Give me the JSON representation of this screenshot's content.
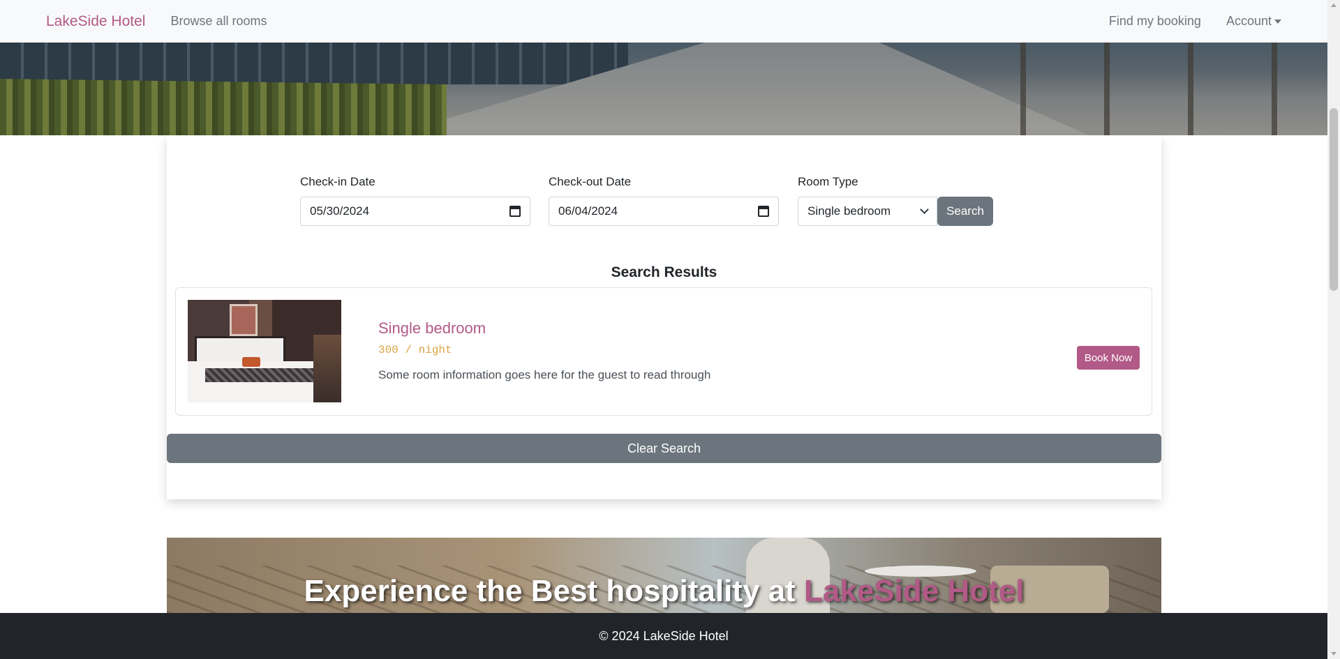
{
  "navbar": {
    "brand": "LakeSide Hotel",
    "browse": "Browse all rooms",
    "find_booking": "Find my booking",
    "account": "Account"
  },
  "search": {
    "checkin_label": "Check-in Date",
    "checkin_value": "05/30/2024",
    "checkout_label": "Check-out Date",
    "checkout_value": "06/04/2024",
    "roomtype_label": "Room Type",
    "roomtype_value": "Single bedroom",
    "search_button": "Search"
  },
  "results": {
    "title": "Search Results",
    "items": [
      {
        "name": "Single bedroom",
        "price": "300 / night",
        "description": "Some room information goes here for the guest to read through",
        "book_button": "Book Now"
      }
    ],
    "clear_button": "Clear Search"
  },
  "banner": {
    "text_prefix": "Experience the Best hospitality at ",
    "text_highlight": "LakeSide Hotel"
  },
  "footer": {
    "copyright": "© 2024 LakeSide Hotel"
  },
  "colors": {
    "brand": "#b25a87",
    "secondary": "#6c757d",
    "price": "#d9a441",
    "footer_bg": "#212529"
  }
}
